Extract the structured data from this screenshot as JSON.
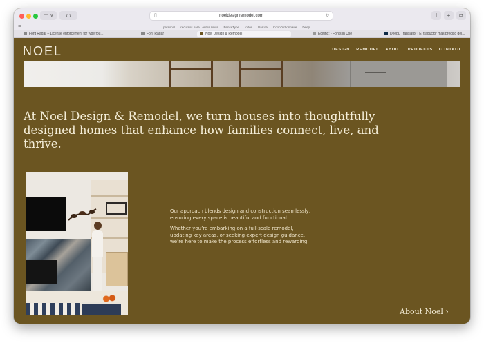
{
  "browser": {
    "url": "noeldesignremodel.com",
    "bookmarks": [
      "personal",
      "recursos para...entos niños",
      "PenseType",
      "todos",
      "Balcoa",
      "CoopDictionnaire",
      "Deepl"
    ],
    "tabs": [
      {
        "label": "Font Radar – License enforcement for type fou...",
        "active": false
      },
      {
        "label": "Font Radar",
        "active": false
      },
      {
        "label": "Noel Design & Remodel",
        "active": true
      },
      {
        "label": "Editing: - Fonts in Use",
        "active": false
      },
      {
        "label": "DeepL Translator | El traductor más preciso del...",
        "active": false
      }
    ]
  },
  "site": {
    "logo": "NOEL",
    "nav": [
      "DESIGN",
      "REMODEL",
      "ABOUT",
      "PROJECTS",
      "CONTACT"
    ],
    "headline": "At Noel Design & Remodel, we turn houses into thoughtfully designed homes that enhance how families connect, live, and thrive.",
    "paragraph_1": "Our approach blends design and construction seamlessly, ensuring every space is beautiful and functional.",
    "paragraph_2": "Whether you’re embarking on a full-scale remodel, updating key areas, or seeking expert design guidance, we’re here to make the process effortless and rewarding.",
    "about_link": "About Noel ›"
  },
  "colors": {
    "page_bg": "#6b5521",
    "text_light": "#f4edd7"
  },
  "icons": [
    "sidebar-icon",
    "back-icon",
    "forward-icon",
    "shield-icon",
    "share-icon",
    "new-tab-icon",
    "tabs-overview-icon"
  ]
}
